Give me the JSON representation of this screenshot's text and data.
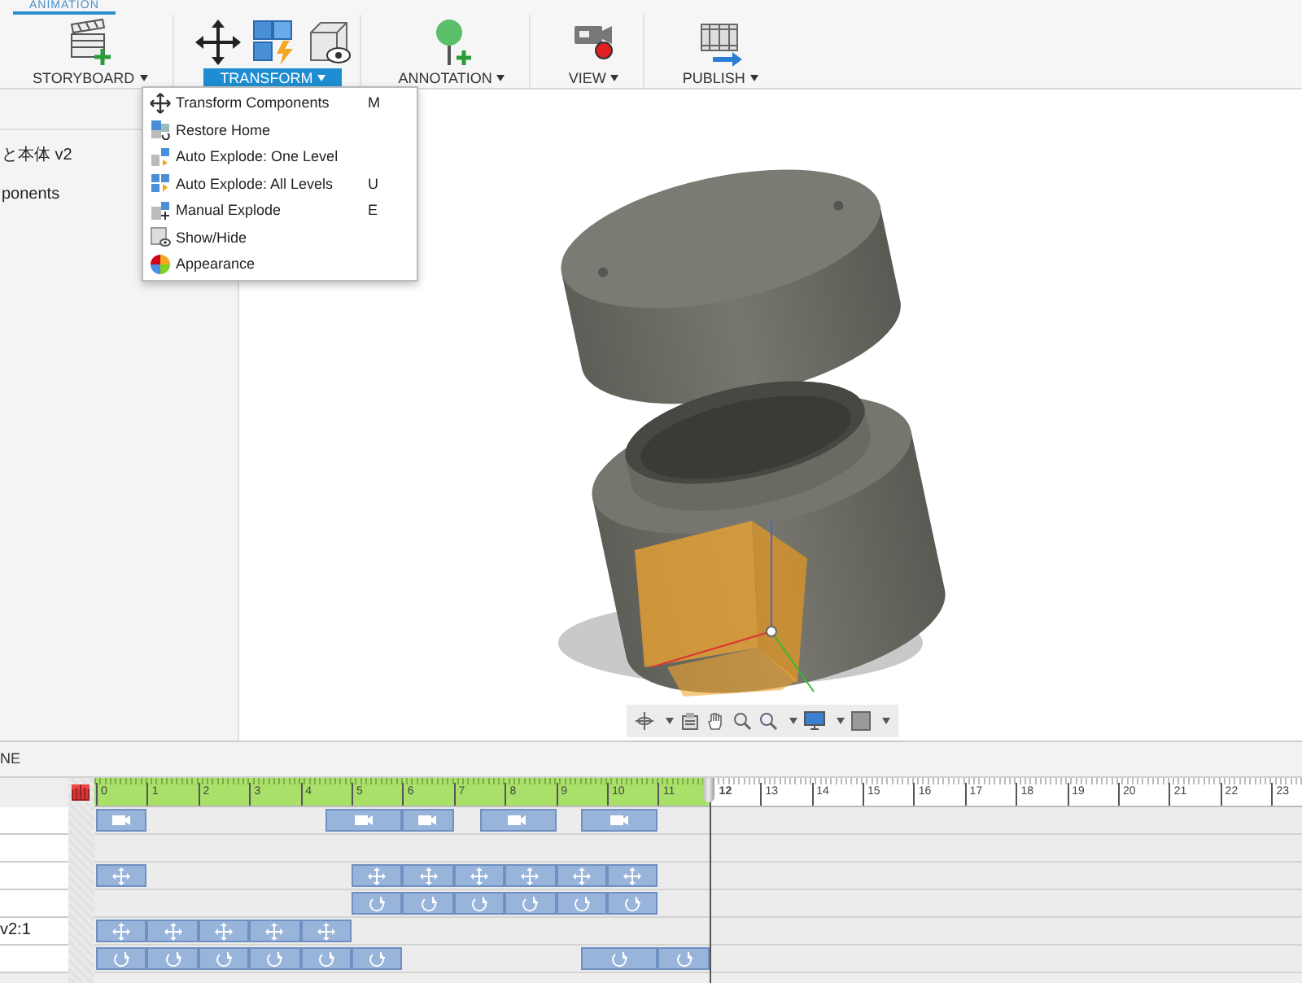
{
  "app_tab": {
    "label": "ANIMATION",
    "selected": true
  },
  "toolbar": {
    "groups": [
      {
        "kind": "storyboard",
        "label": "STORYBOARD",
        "selected": false
      },
      {
        "kind": "transform",
        "label": "TRANSFORM",
        "selected": true
      },
      {
        "kind": "annotation",
        "label": "ANNOTATION",
        "selected": false
      },
      {
        "kind": "view",
        "label": "VIEW",
        "selected": false
      },
      {
        "kind": "publish",
        "label": "PUBLISH",
        "selected": false
      }
    ]
  },
  "menu": {
    "items": [
      {
        "kind": "move",
        "label": "Transform Components",
        "shortcut": "M"
      },
      {
        "kind": "restore",
        "label": "Restore Home"
      },
      {
        "kind": "explode-one",
        "label": "Auto Explode: One Level"
      },
      {
        "kind": "explode-all",
        "label": "Auto Explode: All Levels",
        "shortcut": "U"
      },
      {
        "kind": "manual",
        "label": "Manual Explode",
        "shortcut": "E"
      },
      {
        "kind": "show-hide",
        "label": "Show/Hide"
      },
      {
        "kind": "appearance",
        "label": "Appearance"
      }
    ]
  },
  "browser": {
    "items": [
      {
        "label": "と本体 v2"
      },
      {
        "label": "ponents"
      }
    ]
  },
  "timeline": {
    "title": "NE",
    "ruler": [
      {
        "label": "0",
        "selected": false
      },
      {
        "label": "1",
        "selected": false
      },
      {
        "label": "2",
        "selected": false
      },
      {
        "label": "3",
        "selected": false
      },
      {
        "label": "4",
        "selected": false
      },
      {
        "label": "5",
        "selected": false
      },
      {
        "label": "6",
        "selected": false
      },
      {
        "label": "7",
        "selected": false
      },
      {
        "label": "8",
        "selected": false
      },
      {
        "label": "9",
        "selected": false
      },
      {
        "label": "10",
        "selected": false
      },
      {
        "label": "11",
        "selected": false
      },
      {
        "label": "12",
        "selected": true
      },
      {
        "label": "13",
        "selected": false
      },
      {
        "label": "14",
        "selected": false
      },
      {
        "label": "15",
        "selected": false
      },
      {
        "label": "16",
        "selected": false
      },
      {
        "label": "17",
        "selected": false
      },
      {
        "label": "18",
        "selected": false
      },
      {
        "label": "19",
        "selected": false
      },
      {
        "label": "20",
        "selected": false
      },
      {
        "label": "21",
        "selected": false
      },
      {
        "label": "22",
        "selected": false
      },
      {
        "label": "23",
        "selected": false
      }
    ],
    "tracks": [
      {
        "kind": "keyframes",
        "items": [
          {
            "kind": "camera",
            "wide": false
          },
          {
            "kind": "gap"
          },
          {
            "kind": "gap"
          },
          {
            "kind": "gap"
          },
          {
            "kind": "gap"
          },
          {
            "kind": "gap"
          },
          {
            "kind": "gap"
          },
          {
            "kind": "gap"
          },
          {
            "kind": "camera",
            "wide": true
          },
          {
            "kind": "camera",
            "wide": false
          },
          {
            "kind": "gap"
          },
          {
            "kind": "camera",
            "wide": true
          },
          {
            "kind": "gap"
          },
          {
            "kind": "camera",
            "wide": true
          }
        ]
      },
      {
        "kind": "blank"
      },
      {
        "kind": "keyframes",
        "items": [
          {
            "kind": "move",
            "wide": false
          },
          {
            "kind": "gap"
          },
          {
            "kind": "gap"
          },
          {
            "kind": "gap"
          },
          {
            "kind": "gap"
          },
          {
            "kind": "gap"
          },
          {
            "kind": "gap"
          },
          {
            "kind": "gap"
          },
          {
            "kind": "gap"
          },
          {
            "kind": "move",
            "wide": false
          },
          {
            "kind": "move",
            "wide": false
          },
          {
            "kind": "move",
            "wide": false
          },
          {
            "kind": "move",
            "wide": false
          },
          {
            "kind": "move",
            "wide": false
          },
          {
            "kind": "move",
            "wide": false
          }
        ]
      },
      {
        "kind": "keyframes",
        "items": [
          {
            "kind": "gap"
          },
          {
            "kind": "gap"
          },
          {
            "kind": "gap"
          },
          {
            "kind": "gap"
          },
          {
            "kind": "gap"
          },
          {
            "kind": "gap"
          },
          {
            "kind": "gap"
          },
          {
            "kind": "gap"
          },
          {
            "kind": "gap"
          },
          {
            "kind": "gap"
          },
          {
            "kind": "rotate",
            "wide": false
          },
          {
            "kind": "rotate",
            "wide": false
          },
          {
            "kind": "rotate",
            "wide": false
          },
          {
            "kind": "rotate",
            "wide": false
          },
          {
            "kind": "rotate",
            "wide": false
          },
          {
            "kind": "rotate",
            "wide": false
          }
        ]
      },
      {
        "kind": "keyframes",
        "label": "v2:1",
        "items": [
          {
            "kind": "move",
            "wide": false
          },
          {
            "kind": "move",
            "wide": false
          },
          {
            "kind": "move",
            "wide": false
          },
          {
            "kind": "move",
            "wide": false
          },
          {
            "kind": "move",
            "wide": false
          }
        ]
      },
      {
        "kind": "keyframes",
        "items": [
          {
            "kind": "rotate",
            "wide": false
          },
          {
            "kind": "rotate",
            "wide": false
          },
          {
            "kind": "rotate",
            "wide": false
          },
          {
            "kind": "rotate",
            "wide": false
          },
          {
            "kind": "rotate",
            "wide": false
          },
          {
            "kind": "rotate",
            "wide": false
          },
          {
            "kind": "gap"
          },
          {
            "kind": "gap"
          },
          {
            "kind": "gap"
          },
          {
            "kind": "gap"
          },
          {
            "kind": "gap"
          },
          {
            "kind": "gap"
          },
          {
            "kind": "gap"
          },
          {
            "kind": "rotate",
            "wide": true
          },
          {
            "kind": "rotate",
            "wide": false
          }
        ]
      }
    ]
  }
}
